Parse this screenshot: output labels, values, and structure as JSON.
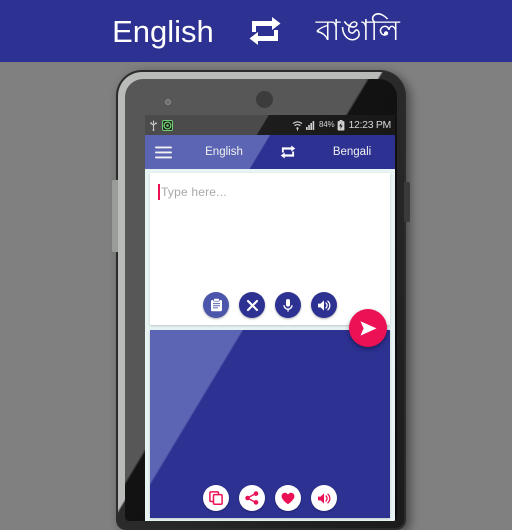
{
  "promo_banner": {
    "source_language": "English",
    "swap_icon": "swap-horizontal-icon",
    "target_language": "বাঙালি",
    "background_color": "#2d3191",
    "text_color": "#ffffff"
  },
  "page": {
    "background_color": "#808080"
  },
  "phone": {
    "body_color": "#2b2b2b",
    "chassis_color": "#b9bbb9"
  },
  "status_bar": {
    "usb_icon": "usb-icon",
    "app_icon": "circle-target-icon",
    "wifi_icon": "wifi-icon",
    "signal_icon": "cellular-signal-icon",
    "battery_percent": "84%",
    "battery_icon": "battery-charging-icon",
    "clock": "12:23 PM",
    "background_color": "#1d1d1d",
    "text_color": "#d6d6d6"
  },
  "app_bar": {
    "menu_icon": "hamburger-menu-icon",
    "source_language": "English",
    "swap_icon": "swap-horizontal-icon",
    "target_language": "Bengali",
    "background_color": "#2d3191",
    "highlight_color": "#5b65b4"
  },
  "source_card": {
    "placeholder": "Type here...",
    "value": "",
    "caret_color": "#ec1055",
    "background_color": "#ffffff",
    "placeholder_color": "#a8a8a8",
    "actions": [
      {
        "name": "paste-button",
        "icon": "clipboard-icon",
        "label": "Paste"
      },
      {
        "name": "clear-button",
        "icon": "close-icon",
        "label": "Clear"
      },
      {
        "name": "mic-button",
        "icon": "microphone-icon",
        "label": "Speak"
      },
      {
        "name": "speak-button",
        "icon": "speaker-icon",
        "label": "Listen"
      }
    ]
  },
  "send_fab": {
    "icon": "send-icon",
    "label": "Translate",
    "background_color": "#ec1055",
    "icon_color": "#ffffff"
  },
  "target_card": {
    "value": "",
    "background_color": "#2d3191",
    "highlight_color": "#5b65b4",
    "actions": [
      {
        "name": "copy-button",
        "icon": "copy-icon",
        "label": "Copy"
      },
      {
        "name": "share-button",
        "icon": "share-icon",
        "label": "Share"
      },
      {
        "name": "favorite-button",
        "icon": "heart-icon",
        "label": "Favorite"
      },
      {
        "name": "speak-button",
        "icon": "speaker-icon",
        "label": "Listen"
      }
    ]
  }
}
